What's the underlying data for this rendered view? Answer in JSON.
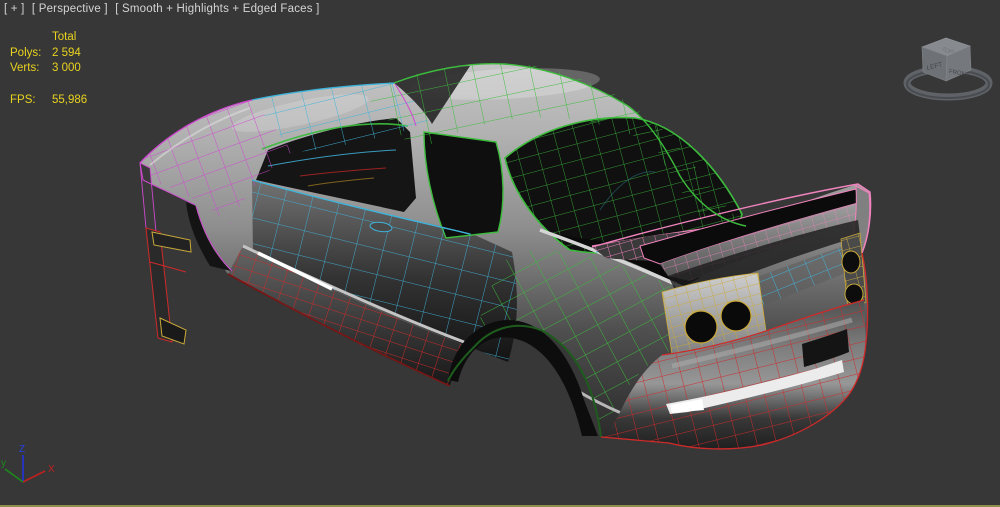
{
  "viewport": {
    "menus": {
      "general": "[ + ]",
      "pov": "[ Perspective ]",
      "shading": "[ Smooth + Highlights + Edged Faces ]"
    },
    "background_color": "#373737",
    "active_border_color": "#8f8f4d",
    "label_color": "#d4d4d4"
  },
  "stats": {
    "header": "Total",
    "rows": [
      {
        "label": "Polys:",
        "value": "2 594"
      },
      {
        "label": "Verts:",
        "value": "3 000"
      }
    ],
    "fps": {
      "label": "FPS:",
      "value": "55,986"
    },
    "text_color": "#e9d31f"
  },
  "viewcube": {
    "front": "FRONT",
    "left": "LEFT",
    "top": "TOP"
  },
  "axis_gizmo": {
    "x": "X",
    "y": "y",
    "z": "Z",
    "x_color": "#c02020",
    "y_color": "#1d8a1d",
    "z_color": "#2233dd"
  },
  "model": {
    "description": "car body polygon mesh, rear three-quarter view",
    "wire_colors": {
      "roof_quarter": "#3cbb3c",
      "hood_door_trunk": "#3fb3da",
      "front_fender": "#cf49cf",
      "spoiler": "#f083bd",
      "rocker_bumper": "#cf2a2a",
      "tail_panel": "#c9a93a",
      "arch_trim": "#1d5c1d"
    }
  }
}
